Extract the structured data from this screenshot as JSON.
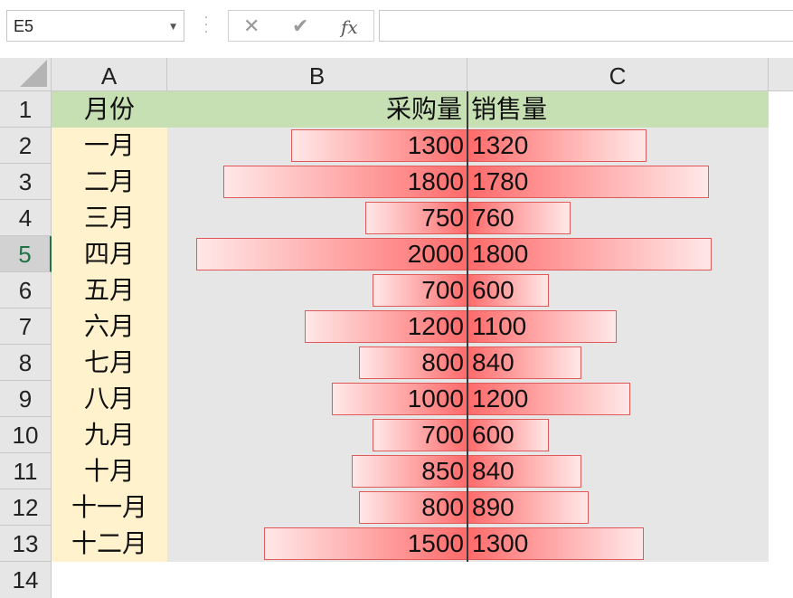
{
  "formula_bar": {
    "name_box": "E5",
    "cancel_icon": "✕",
    "confirm_icon": "✔",
    "fx_label": "fx",
    "formula_value": ""
  },
  "columns": [
    "A",
    "B",
    "C"
  ],
  "header_row": {
    "row_number": "1",
    "a": "月份",
    "b": "采购量",
    "c": "销售量"
  },
  "active_row": "5",
  "next_row_number": "14",
  "colors": {
    "header_fill": "#c6e0b4",
    "month_fill": "#fff2cc",
    "data_fill": "#e7e6e6",
    "bar_color": "#ff6b6b"
  },
  "chart_data": {
    "type": "bar",
    "categories": [
      "一月",
      "二月",
      "三月",
      "四月",
      "五月",
      "六月",
      "七月",
      "八月",
      "九月",
      "十月",
      "十一月",
      "十二月"
    ],
    "series": [
      {
        "name": "采购量",
        "values": [
          1300,
          1800,
          750,
          2000,
          700,
          1200,
          800,
          1000,
          700,
          850,
          800,
          1500
        ]
      },
      {
        "name": "销售量",
        "values": [
          1320,
          1780,
          760,
          1800,
          600,
          1100,
          840,
          1200,
          600,
          840,
          890,
          1300
        ]
      }
    ],
    "xlim": [
      0,
      2000
    ]
  },
  "rows": [
    {
      "row_number": "2",
      "month": "一月",
      "purchase": "1300",
      "sales": "1320"
    },
    {
      "row_number": "3",
      "month": "二月",
      "purchase": "1800",
      "sales": "1780"
    },
    {
      "row_number": "4",
      "month": "三月",
      "purchase": "750",
      "sales": "760"
    },
    {
      "row_number": "5",
      "month": "四月",
      "purchase": "2000",
      "sales": "1800"
    },
    {
      "row_number": "6",
      "month": "五月",
      "purchase": "700",
      "sales": "600"
    },
    {
      "row_number": "7",
      "month": "六月",
      "purchase": "1200",
      "sales": "1100"
    },
    {
      "row_number": "8",
      "month": "七月",
      "purchase": "800",
      "sales": "840"
    },
    {
      "row_number": "9",
      "month": "八月",
      "purchase": "1000",
      "sales": "1200"
    },
    {
      "row_number": "10",
      "month": "九月",
      "purchase": "700",
      "sales": "600"
    },
    {
      "row_number": "11",
      "month": "十月",
      "purchase": "850",
      "sales": "840"
    },
    {
      "row_number": "12",
      "month": "十一月",
      "purchase": "800",
      "sales": "890"
    },
    {
      "row_number": "13",
      "month": "十二月",
      "purchase": "1500",
      "sales": "1300"
    }
  ]
}
